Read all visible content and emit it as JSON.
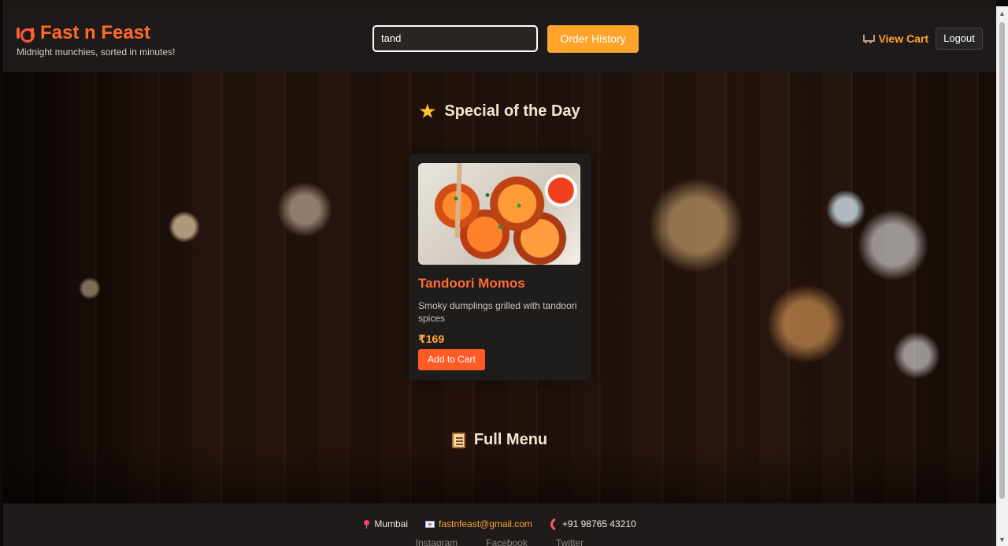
{
  "header": {
    "brand_title": "Fast n Feast",
    "brand_subtitle": "Midnight munchies, sorted in minutes!",
    "search_value": "tand",
    "order_history_label": "Order History",
    "view_cart_label": "View Cart",
    "logout_label": "Logout"
  },
  "special": {
    "title": "Special of the Day",
    "item": {
      "name": "Tandoori Momos",
      "description": "Smoky dumplings grilled with tandoori spices",
      "price": "₹169",
      "button_label": "Add to Cart"
    }
  },
  "menu": {
    "title": "Full Menu"
  },
  "footer": {
    "location": "Mumbai",
    "email": "fastnfeast@gmail.com",
    "phone": "+91 98765 43210",
    "social": [
      "Instagram",
      "Facebook",
      "Twitter"
    ]
  },
  "icons": {
    "brand": "plate-icon",
    "special": "star-icon",
    "cart": "cart-icon",
    "menu": "scroll-icon",
    "location": "pin-icon",
    "email": "mail-icon",
    "phone": "phone-icon"
  },
  "colors": {
    "accent": "#ff6a2b",
    "button": "#ffa42b",
    "header_background": "#1d1a19"
  }
}
